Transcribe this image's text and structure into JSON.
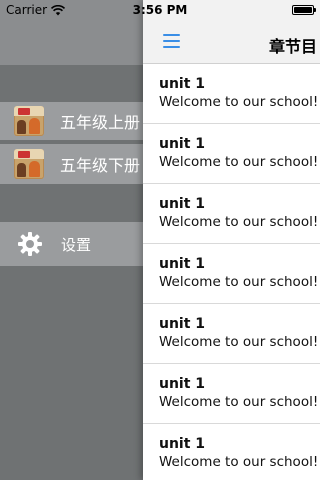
{
  "status_bar": {
    "carrier": "Carrier",
    "time": "3:56 PM"
  },
  "drawer": {
    "items": [
      {
        "label": "五年级上册",
        "icon": "book-cover-icon"
      },
      {
        "label": "五年级下册",
        "icon": "book-cover-icon"
      }
    ],
    "settings": {
      "label": "设置",
      "icon": "gear-icon"
    }
  },
  "navbar": {
    "title": "章节目",
    "menu_icon": "hamburger-menu-icon",
    "accent_color": "#3a8ee6"
  },
  "list": {
    "cells": [
      {
        "title": "unit 1",
        "subtitle": "Welcome to our school! L"
      },
      {
        "title": "unit 1",
        "subtitle": "Welcome to our school! L"
      },
      {
        "title": "unit 1",
        "subtitle": "Welcome to our school! L"
      },
      {
        "title": "unit 1",
        "subtitle": "Welcome to our school! L"
      },
      {
        "title": "unit 1",
        "subtitle": "Welcome to our school! L"
      },
      {
        "title": "unit 1",
        "subtitle": "Welcome to our school! L"
      },
      {
        "title": "unit 1",
        "subtitle": "Welcome to our school! R"
      }
    ]
  }
}
